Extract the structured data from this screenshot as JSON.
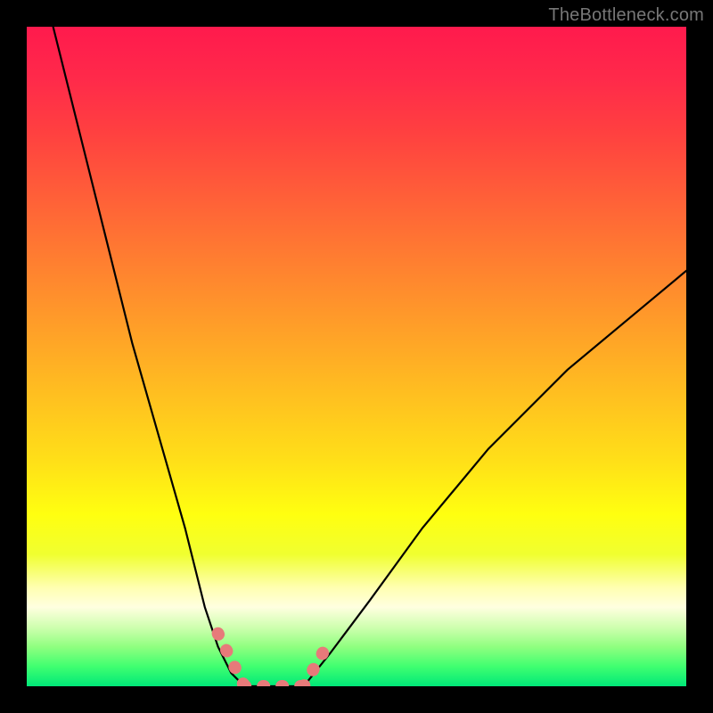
{
  "watermark": "TheBottleneck.com",
  "colors": {
    "black_frame": "#000000",
    "curve_black": "#000000",
    "highlight_pink": "#e77a7a",
    "gradient_top": "#ff1a4d",
    "gradient_yellow": "#ffff10",
    "gradient_green": "#00e878"
  },
  "chart_data": {
    "type": "line",
    "title": "",
    "xlabel": "",
    "ylabel": "",
    "xlim": [
      0,
      100
    ],
    "ylim": [
      0,
      100
    ],
    "series": [
      {
        "name": "left-branch",
        "x": [
          4,
          8,
          12,
          16,
          20,
          24,
          27,
          29,
          31,
          33
        ],
        "values": [
          100,
          84,
          68,
          52,
          38,
          24,
          12,
          6,
          2,
          0
        ]
      },
      {
        "name": "valley-floor",
        "x": [
          33,
          36,
          39,
          42
        ],
        "values": [
          0,
          0,
          0,
          0
        ]
      },
      {
        "name": "right-branch",
        "x": [
          42,
          46,
          52,
          60,
          70,
          82,
          94,
          100
        ],
        "values": [
          0,
          5,
          13,
          24,
          36,
          48,
          58,
          63
        ]
      }
    ],
    "highlight_segments": [
      {
        "name": "left-dip",
        "x": [
          29,
          33
        ],
        "values": [
          8,
          0
        ]
      },
      {
        "name": "floor",
        "x": [
          33,
          42
        ],
        "values": [
          0,
          0
        ]
      },
      {
        "name": "right-rise",
        "x": [
          42,
          46
        ],
        "values": [
          0,
          7
        ]
      }
    ]
  }
}
